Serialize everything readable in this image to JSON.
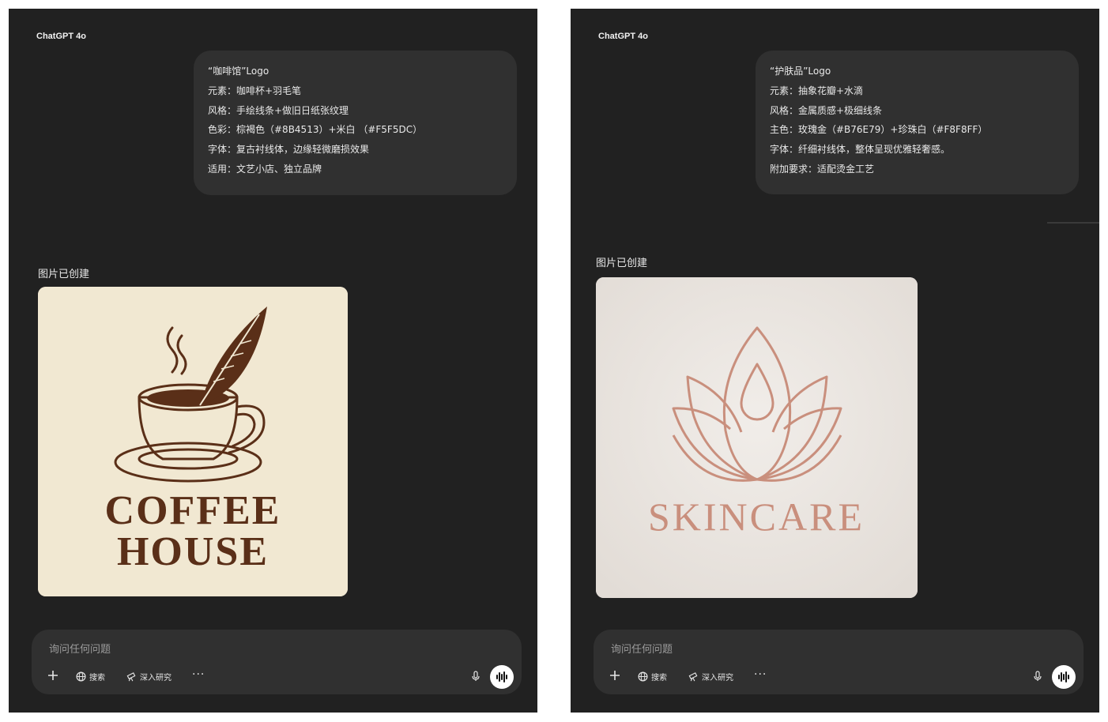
{
  "panels": [
    {
      "model_label": "ChatGPT 4o",
      "prompt_lines": [
        "“咖啡馆”Logo",
        "元素：咖啡杯+羽毛笔",
        "风格：手绘线条+做旧日纸张纹理",
        "色彩：棕褐色（#8B4513）+米白 （#F5F5DC）",
        "字体：复古衬线体，边缘轻微磨损效果",
        "适用：文艺小店、独立品牌"
      ],
      "image_created_label": "图片已创建",
      "image": {
        "line1": "COFFEE",
        "line2": "HOUSE",
        "ink_color": "#5a2f18",
        "paper_color": "#f1e8d2"
      }
    },
    {
      "model_label": "ChatGPT 4o",
      "prompt_lines": [
        "“护肤品”Logo",
        "元素：抽象花瓣+水滴",
        "风格：金属质感+极细线条",
        "主色：玫瑰金（#B76E79）+珍珠白（#F8F8FF）",
        "字体：纤细衬线体，整体呈现优雅轻奢感。",
        "附加要求：适配烫金工艺"
      ],
      "image_created_label": "图片已创建",
      "image": {
        "text": "SKINCARE",
        "foil_color": "#c98f7d",
        "paper_color": "#ebe6e1"
      }
    }
  ],
  "composer": {
    "placeholder": "询问任何问题",
    "search_label": "搜索",
    "research_label": "深入研究",
    "more_label": "···",
    "icons": [
      "plus-icon",
      "globe-icon",
      "telescope-icon",
      "more-icon",
      "mic-icon",
      "voice-wave-icon"
    ]
  },
  "colors": {
    "panel_bg": "#212121",
    "bubble_bg": "#303030"
  }
}
